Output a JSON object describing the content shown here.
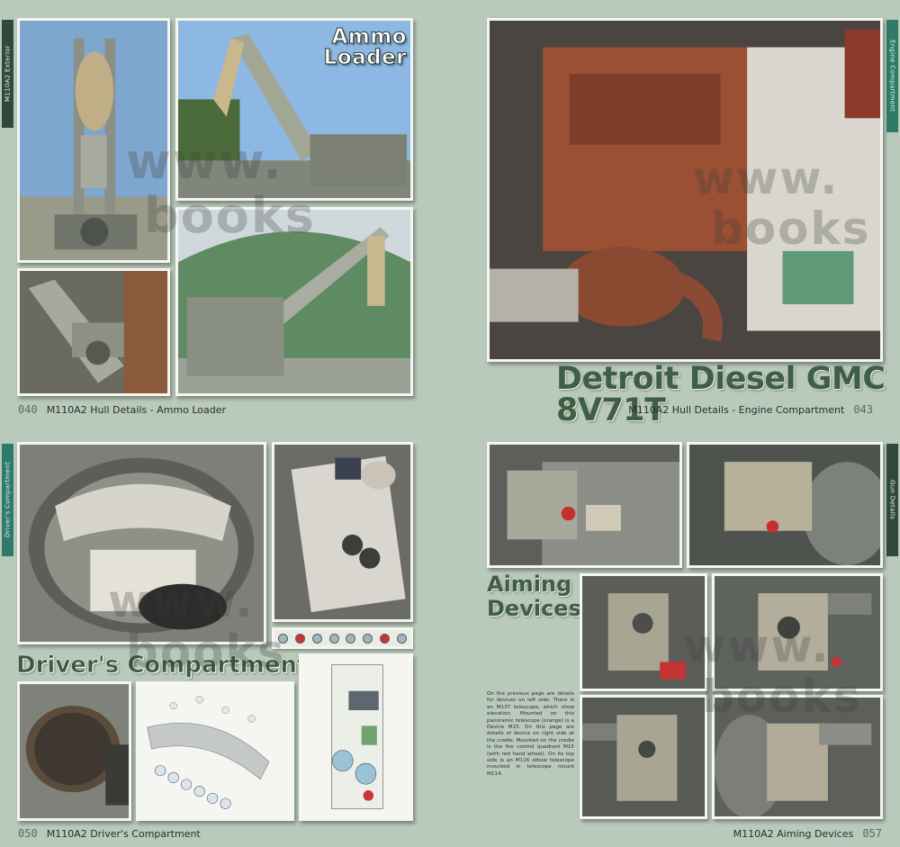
{
  "spreads": {
    "p040": {
      "side_tab": "M110A2 Exterior",
      "page_num": "040",
      "footer": "M110A2 Hull Details - Ammo Loader",
      "title_line1": "Ammo",
      "title_line2": "Loader"
    },
    "p043": {
      "side_tab": "Engine Compartment",
      "page_num": "043",
      "footer": "M110A2 Hull Details - Engine Compartment",
      "title": "Detroit Diesel GMC 8V71T"
    },
    "p050": {
      "side_tab": "Driver's Compartment",
      "page_num": "050",
      "footer": "M110A2 Driver's Compartment",
      "title": "Driver's Compartment"
    },
    "p057": {
      "side_tab": "Gun Details",
      "page_num": "057",
      "footer": "M110A2 Aiming Devices",
      "title_line1": "Aiming",
      "title_line2": "Devices",
      "caption": "On the previous page are details for devices on left side. There is an M137 telescope, which show elevation. Mounted on this panoramic telescope (orange) is a Device M15. On this page are details of device on right side at the cradle. Mounted on the cradle is the fire control quadrant M15 (with red hand wheel). On its top side is an M116 elbow telescope mounted in telescope mount M114."
    }
  },
  "watermark": {
    "line1": "www.",
    "line2": "books"
  },
  "colors": {
    "background": "#b9c9bb",
    "title_green": "#3f5f45",
    "tab_dark": "#2f4a3a",
    "tab_accent": "#2e7b6a"
  }
}
